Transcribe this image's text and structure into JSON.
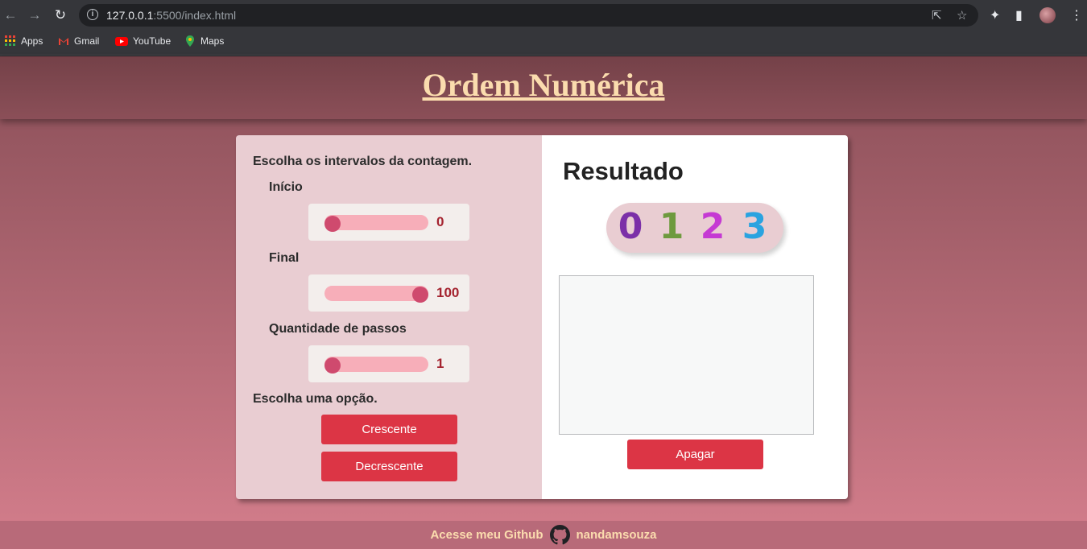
{
  "browser": {
    "url_host": "127.0.0.1",
    "url_rest": ":5500/index.html",
    "bookmarks": [
      {
        "label": "Apps",
        "icon": "apps-grid-icon"
      },
      {
        "label": "Gmail",
        "icon": "gmail-icon"
      },
      {
        "label": "YouTube",
        "icon": "youtube-icon"
      },
      {
        "label": "Maps",
        "icon": "maps-icon"
      }
    ]
  },
  "header": {
    "title": "Ordem Numérica"
  },
  "form": {
    "intro": "Escolha os intervalos da contagem.",
    "inicio": {
      "label": "Início",
      "value": "0",
      "fraction": 0
    },
    "final": {
      "label": "Final",
      "value": "100",
      "fraction": 1
    },
    "passos": {
      "label": "Quantidade de passos",
      "value": "1",
      "fraction": 0
    },
    "option_label": "Escolha uma opção.",
    "btn_crescente": "Crescente",
    "btn_decrescente": "Decrescente"
  },
  "result": {
    "title": "Resultado",
    "digits": [
      "0",
      "1",
      "2",
      "3"
    ],
    "digit_colors": [
      "#7b2fa8",
      "#6e9a3e",
      "#c53ad3",
      "#2aa3e0"
    ],
    "output": "",
    "btn_apagar": "Apagar"
  },
  "footer": {
    "text": "Acesse meu Github",
    "username": "nandamsouza"
  },
  "colors": {
    "accent": "#dc3545",
    "title": "#fbdcae"
  }
}
